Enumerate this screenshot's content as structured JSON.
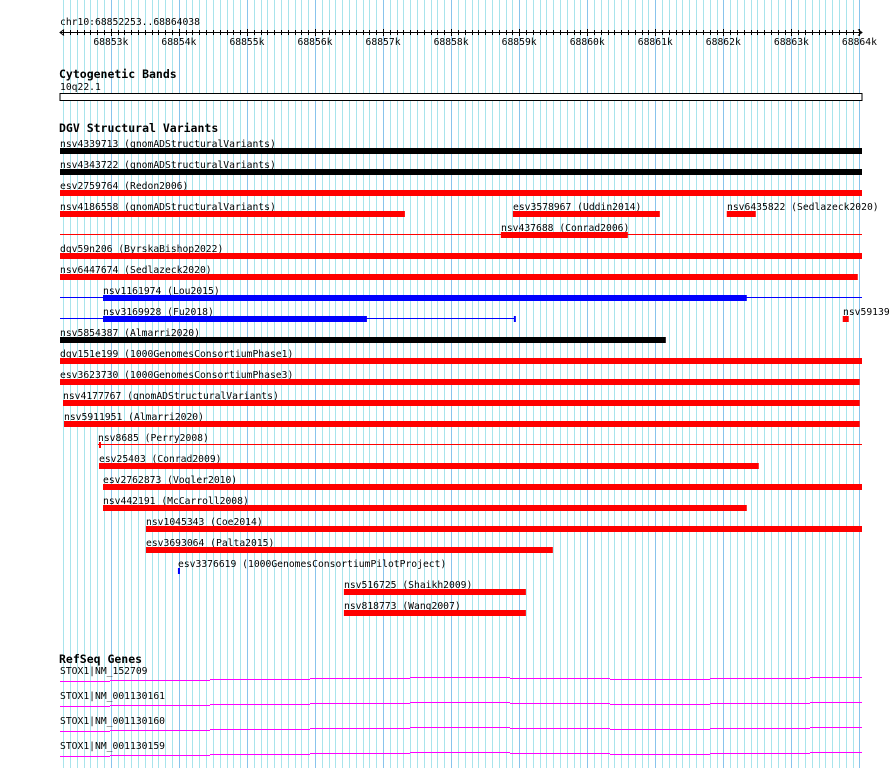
{
  "view": {
    "chrom": "chr10",
    "start": 68852253,
    "end": 68864038,
    "position_label": "chr10:68852253..68864038"
  },
  "ruler": {
    "tick_labels": [
      "68853k",
      "68854k",
      "68855k",
      "68856k",
      "68857k",
      "68858k",
      "68859k",
      "68860k",
      "68861k",
      "68862k",
      "68863k",
      "68864k"
    ]
  },
  "colors": {
    "grid_minor": "#a8e4ec",
    "grid_major": "#88c4ec",
    "black": "#000000",
    "red": "#ff0000",
    "blue": "#0000ff",
    "gene": "#ff00ff"
  },
  "cytoband_track": {
    "title": "Cytogenetic Bands",
    "band": {
      "name": "10q22.1",
      "start": 68852253,
      "end": 68864038
    }
  },
  "dgv_track": {
    "title": "DGV Structural Variants",
    "rows": [
      [
        {
          "id": "nsv4339713",
          "source": "gnomADStructuralVariants",
          "label": "nsv4339713 (gnomADStructuralVariants)",
          "color": "black",
          "start": 68852253,
          "end": 68864038
        }
      ],
      [
        {
          "id": "nsv4343722",
          "source": "gnomADStructuralVariants",
          "label": "nsv4343722 (gnomADStructuralVariants)",
          "color": "black",
          "start": 68852253,
          "end": 68864038
        }
      ],
      [
        {
          "id": "esv2759764",
          "source": "Redon2006",
          "label": "esv2759764 (Redon2006)",
          "color": "red",
          "start": 68852253,
          "end": 68864038
        }
      ],
      [
        {
          "id": "nsv4186558",
          "source": "gnomADStructuralVariants",
          "label": "nsv4186558 (gnomADStructuralVariants)",
          "color": "red",
          "start": 68852253,
          "end": 68857321
        },
        {
          "id": "esv3578967",
          "source": "Uddin2014",
          "label": "esv3578967 (Uddin2014)",
          "color": "red",
          "start": 68858908,
          "end": 68861067
        },
        {
          "id": "nsv6435822",
          "source": "Sedlazeck2020",
          "label": "nsv6435822 (Sedlazeck2020)",
          "color": "red",
          "start": 68862051,
          "end": 68862477
        }
      ],
      [
        {
          "id": "nsv437688",
          "source": "Conrad2006",
          "label": "nsv437688 (Conrad2006)",
          "color": "red",
          "start": 68858731,
          "end": 68860597,
          "outer_start": 68852253,
          "outer_end": 68864038
        }
      ],
      [
        {
          "id": "dgv59n206",
          "source": "ByrskaBishop2022",
          "label": "dgv59n206 (ByrskaBishop2022)",
          "color": "red",
          "start": 68852253,
          "end": 68864038
        }
      ],
      [
        {
          "id": "nsv6447674",
          "source": "Sedlazeck2020",
          "label": "nsv6447674 (Sedlazeck2020)",
          "color": "red",
          "start": 68852253,
          "end": 68863976
        }
      ],
      [
        {
          "id": "nsv1161974",
          "source": "Lou2015",
          "label": "nsv1161974 (Lou2015)",
          "color": "blue",
          "start": 68852885,
          "end": 68862345,
          "outer_start": 68852253,
          "outer_end": 68864038
        }
      ],
      [
        {
          "id": "nsv3169928",
          "source": "Fu2018",
          "label": "nsv3169928 (Fu2018)",
          "color": "blue",
          "start": 68852885,
          "end": 68856763,
          "outer_start": 68852253,
          "outer_end": 68858937,
          "end_tick": true
        },
        {
          "id": "nsv59139",
          "label": "nsv59139",
          "color": "red",
          "start": 68863755,
          "end": 68863843,
          "small": true
        }
      ],
      [
        {
          "id": "nsv5854387",
          "source": "Almarri2020",
          "label": "nsv5854387 (Almarri2020)",
          "color": "black",
          "start": 68852253,
          "end": 68861155
        }
      ],
      [
        {
          "id": "dgv151e199",
          "source": "1000GenomesConsortiumPhase1",
          "label": "dgv151e199 (1000GenomesConsortiumPhase1)",
          "color": "red",
          "start": 68852253,
          "end": 68864038
        }
      ],
      [
        {
          "id": "esv3623730",
          "source": "1000GenomesConsortiumPhase3",
          "label": "esv3623730 (1000GenomesConsortiumPhase3)",
          "color": "red",
          "start": 68852253,
          "end": 68864005,
          "start_tick": true
        }
      ],
      [
        {
          "id": "nsv4177767",
          "source": "gnomADStructuralVariants",
          "label": "nsv4177767 (gnomADStructuralVariants)",
          "color": "red",
          "start": 68852297,
          "end": 68864005
        }
      ],
      [
        {
          "id": "nsv5911951",
          "source": "Almarri2020",
          "label": "nsv5911951 (Almarri2020)",
          "color": "red",
          "start": 68852312,
          "end": 68864005
        }
      ],
      [
        {
          "id": "nsv8685",
          "source": "Perry2008",
          "label": "nsv8685 (Perry2008)",
          "color": "red",
          "start": 68852811,
          "end": 68852811,
          "outer_start": 68852811,
          "outer_end": 68864038,
          "start_tick": true
        }
      ],
      [
        {
          "id": "esv25403",
          "source": "Conrad2009",
          "label": "esv25403 (Conrad2009)",
          "color": "red",
          "start": 68852826,
          "end": 68862521
        }
      ],
      [
        {
          "id": "esv2762873",
          "source": "Vogler2010",
          "label": "esv2762873 (Vogler2010)",
          "color": "red",
          "start": 68852885,
          "end": 68864038
        }
      ],
      [
        {
          "id": "nsv442191",
          "source": "McCarroll2008",
          "label": "nsv442191 (McCarroll2008)",
          "color": "red",
          "start": 68852885,
          "end": 68862345
        }
      ],
      [
        {
          "id": "nsv1045343",
          "source": "Coe2014",
          "label": "nsv1045343 (Coe2014)",
          "color": "red",
          "start": 68853516,
          "end": 68864038
        }
      ],
      [
        {
          "id": "esv3693064",
          "source": "Palta2015",
          "label": "esv3693064 (Palta2015)",
          "color": "red",
          "start": 68853516,
          "end": 68859495
        }
      ],
      [
        {
          "id": "esv3376619",
          "source": "1000GenomesConsortiumPilotProject",
          "label": "esv3376619 (1000GenomesConsortiumPilotProject)",
          "color": "blue",
          "start": 68853986,
          "end": 68854016,
          "small": true
        }
      ],
      [
        {
          "id": "nsv516725",
          "source": "Shaikh2009",
          "label": "nsv516725 (Shaikh2009)",
          "color": "red",
          "start": 68856425,
          "end": 68859099
        }
      ],
      [
        {
          "id": "nsv818773",
          "source": "Wang2007",
          "label": "nsv818773 (Wang2007)",
          "color": "red",
          "start": 68856425,
          "end": 68859099
        }
      ]
    ]
  },
  "refseq_track": {
    "title": "RefSeq Genes",
    "genes": [
      {
        "label": "STOX1|NM_152709"
      },
      {
        "label": "STOX1|NM_001130161"
      },
      {
        "label": "STOX1|NM_001130160"
      },
      {
        "label": "STOX1|NM_001130159"
      }
    ]
  }
}
